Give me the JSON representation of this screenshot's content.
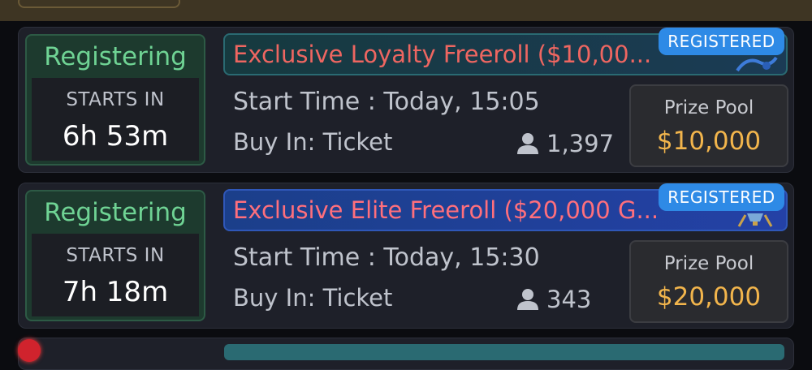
{
  "tournaments": [
    {
      "status": "Registering",
      "starts_in_label": "STARTS IN",
      "countdown": "6h 53m",
      "title": "Exclusive Loyalty Freeroll ($10,00...",
      "badge": "REGISTERED",
      "start_time": "Start Time : Today, 15:05",
      "buy_in": "Buy In:  Ticket",
      "players": "1,397",
      "prize_label": "Prize Pool",
      "prize_value": "$10,000"
    },
    {
      "status": "Registering",
      "starts_in_label": "STARTS IN",
      "countdown": "7h 18m",
      "title": "Exclusive Elite Freeroll ($20,000 G...",
      "badge": "REGISTERED",
      "start_time": "Start Time : Today, 15:30",
      "buy_in": "Buy In:  Ticket",
      "players": "343",
      "prize_label": "Prize Pool",
      "prize_value": "$20,000"
    }
  ],
  "icons": {
    "players": "person-icon",
    "card1_art": "dragon-art",
    "card2_art": "trophy-art",
    "next_card_indicator": "red-dot"
  },
  "colors": {
    "status_green": "#6fd394",
    "title_red": "#ee6661",
    "badge_blue": "#2e8ae6",
    "prize_gold": "#f2b54c",
    "card_bg": "#1e2029"
  }
}
